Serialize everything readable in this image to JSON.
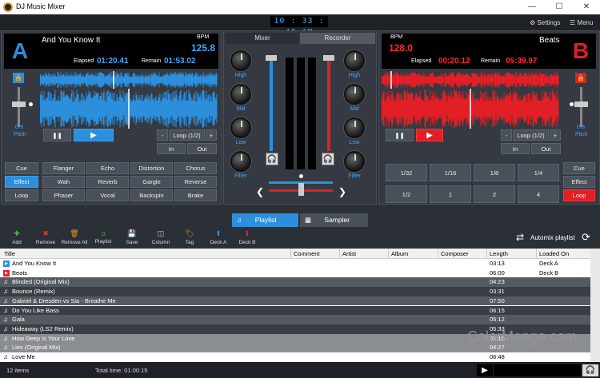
{
  "window": {
    "title": "DJ Music Mixer"
  },
  "toolbar": {
    "clock": "10 : 33 : 40 AM",
    "settings": "Settings",
    "menu": "Menu"
  },
  "deck_a": {
    "letter": "A",
    "track": "And You Know It",
    "bpm_label": "BPM",
    "bpm": "125.8",
    "elapsed_label": "Elapsed",
    "elapsed": "01:20.41",
    "remain_label": "Remain",
    "remain": "01:53.02",
    "pitch_value": "0%",
    "pitch_label": "Pitch",
    "loop": "Loop (1/2)",
    "minus": "-",
    "plus": "+",
    "in": "In",
    "out": "Out",
    "side": [
      "Cue",
      "Effect",
      "Loop"
    ],
    "fx": [
      "Flanger",
      "Echo",
      "Distortion",
      "Chorus",
      "Wah",
      "Reverb",
      "Gargle",
      "Reverse",
      "Phaser",
      "Vocal",
      "Backspin",
      "Brake"
    ]
  },
  "deck_b": {
    "letter": "B",
    "track": "Beats",
    "bpm_label": "BPM",
    "bpm": "128.0",
    "elapsed_label": "Elapsed",
    "elapsed": "00:20.12",
    "remain_label": "Remain",
    "remain": "05:39.97",
    "pitch_value": "0%",
    "pitch_label": "Pitch",
    "loop": "Loop (1/2)",
    "minus": "-",
    "plus": "+",
    "in": "In",
    "out": "Out",
    "side": [
      "Cue",
      "Effect",
      "Loop"
    ],
    "loops": [
      "1/32",
      "1/16",
      "1/8",
      "1/4",
      "1/2",
      "1",
      "2",
      "4"
    ]
  },
  "mixer": {
    "tabs": [
      "Mixer",
      "Recorder"
    ],
    "knobs": [
      "High",
      "Mid",
      "Low",
      "Filter"
    ]
  },
  "list_tabs": [
    "Playlist",
    "Sampler"
  ],
  "list_toolbar": [
    {
      "label": "Add",
      "icon": "plus-icon",
      "color": "#3cc43c"
    },
    {
      "label": "Remove",
      "icon": "x-icon",
      "color": "#e03030"
    },
    {
      "label": "Remove All",
      "icon": "trash-icon",
      "color": "#e0a020"
    },
    {
      "label": "Playlist",
      "icon": "playlist-icon",
      "color": "#60c040"
    },
    {
      "label": "Save",
      "icon": "save-icon",
      "color": "#ccc"
    },
    {
      "label": "Column",
      "icon": "column-icon",
      "color": "#ccc"
    },
    {
      "label": "Tag",
      "icon": "tag-icon",
      "color": "#e0a020"
    },
    {
      "label": "Deck A",
      "icon": "arrow-up-icon",
      "color": "#2b8fdc"
    },
    {
      "label": "Deck B",
      "icon": "arrow-up-icon",
      "color": "#e21f26"
    }
  ],
  "automix": "Automix playlist",
  "columns": [
    "Title",
    "Comment",
    "Artist",
    "Album",
    "Composer",
    "Length",
    "Loaded On"
  ],
  "rows": [
    {
      "title": "And You Know It",
      "length": "03:13",
      "loaded": "Deck A",
      "icon": "deck-a"
    },
    {
      "title": "Beats",
      "length": "06:00",
      "loaded": "Deck B",
      "icon": "deck-b"
    },
    {
      "title": "Blinded (Original Mix)",
      "length": "04:23",
      "loaded": "",
      "icon": "note"
    },
    {
      "title": "Bounce (Remix)",
      "length": "03:31",
      "loaded": "",
      "icon": "note"
    },
    {
      "title": "Gabriel & Dresden vs Sia - Breathe Me",
      "length": "07:50",
      "loaded": "",
      "icon": "note"
    },
    {
      "title": "Do You Like Bass",
      "length": "06:15",
      "loaded": "",
      "icon": "note"
    },
    {
      "title": "Gala",
      "length": "05:12",
      "loaded": "",
      "icon": "note"
    },
    {
      "title": "Hideaway (LS2 Remix)",
      "length": "05:33",
      "loaded": "",
      "icon": "note"
    },
    {
      "title": "How Deep Is Your Love",
      "length": "03:15",
      "loaded": "",
      "icon": "note"
    },
    {
      "title": "Lies (Original Mix)",
      "length": "04:27",
      "loaded": "",
      "icon": "note"
    },
    {
      "title": "Love Me",
      "length": "06:48",
      "loaded": "",
      "icon": "note"
    }
  ],
  "status": {
    "items": "12  items",
    "total": "Total time: 01:00:15"
  },
  "watermark": "ColorMango.com"
}
